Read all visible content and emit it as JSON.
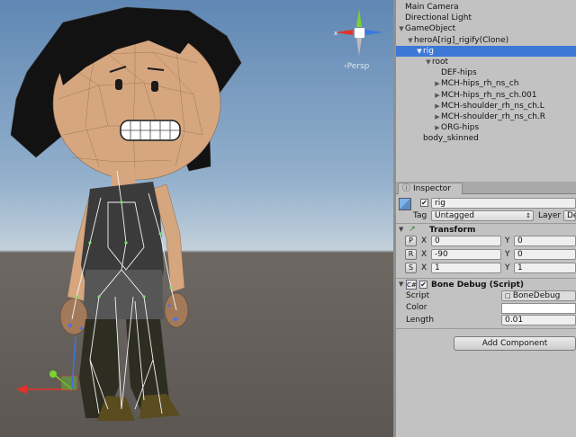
{
  "scene": {
    "persp_label": "‹Persp"
  },
  "hierarchy": {
    "items": [
      {
        "label": "Main Camera",
        "depth": 0,
        "arrow": "",
        "selected": false
      },
      {
        "label": "Directional Light",
        "depth": 0,
        "arrow": "",
        "selected": false
      },
      {
        "label": "GameObject",
        "depth": 0,
        "arrow": "▼",
        "selected": false
      },
      {
        "label": "heroA[rig]_rigify(Clone)",
        "depth": 1,
        "arrow": "▼",
        "selected": false
      },
      {
        "label": "rig",
        "depth": 2,
        "arrow": "▼",
        "selected": true
      },
      {
        "label": "root",
        "depth": 3,
        "arrow": "▼",
        "selected": false
      },
      {
        "label": "DEF-hips",
        "depth": 4,
        "arrow": "",
        "selected": false
      },
      {
        "label": "MCH-hips_rh_ns_ch",
        "depth": 4,
        "arrow": "▶",
        "selected": false
      },
      {
        "label": "MCH-hips_rh_ns_ch.001",
        "depth": 4,
        "arrow": "▶",
        "selected": false
      },
      {
        "label": "MCH-shoulder_rh_ns_ch.L",
        "depth": 4,
        "arrow": "▶",
        "selected": false
      },
      {
        "label": "MCH-shoulder_rh_ns_ch.R",
        "depth": 4,
        "arrow": "▶",
        "selected": false
      },
      {
        "label": "ORG-hips",
        "depth": 4,
        "arrow": "▶",
        "selected": false
      },
      {
        "label": "body_skinned",
        "depth": 2,
        "arrow": "",
        "selected": false
      }
    ]
  },
  "inspector": {
    "tab_label": "Inspector",
    "tab_icon": "ⓘ",
    "object_enabled_check": "✔",
    "object_name": "rig",
    "tag_label": "Tag",
    "tag_value": "Untagged",
    "layer_label": "Layer",
    "layer_value": "De",
    "transform": {
      "title": "Transform",
      "rows": [
        {
          "btn": "P",
          "x": "0",
          "y": "0"
        },
        {
          "btn": "R",
          "x": "-90",
          "y": "0"
        },
        {
          "btn": "S",
          "x": "1",
          "y": "1"
        }
      ],
      "x_label": "X",
      "y_label": "Y"
    },
    "bone_debug": {
      "enabled_check": "✔",
      "title": "Bone Debug (Script)",
      "script_label": "Script",
      "script_value": "BoneDebug",
      "color_label": "Color",
      "color_value": "#ffffff",
      "length_label": "Length",
      "length_value": "0.01"
    },
    "add_component_label": "Add Component"
  },
  "colors": {
    "selection": "#3d78d6",
    "panel": "#c2c2c2",
    "gizmo_x": "#e0322a",
    "gizmo_y": "#7cd42e",
    "gizmo_z": "#3a78e0"
  }
}
